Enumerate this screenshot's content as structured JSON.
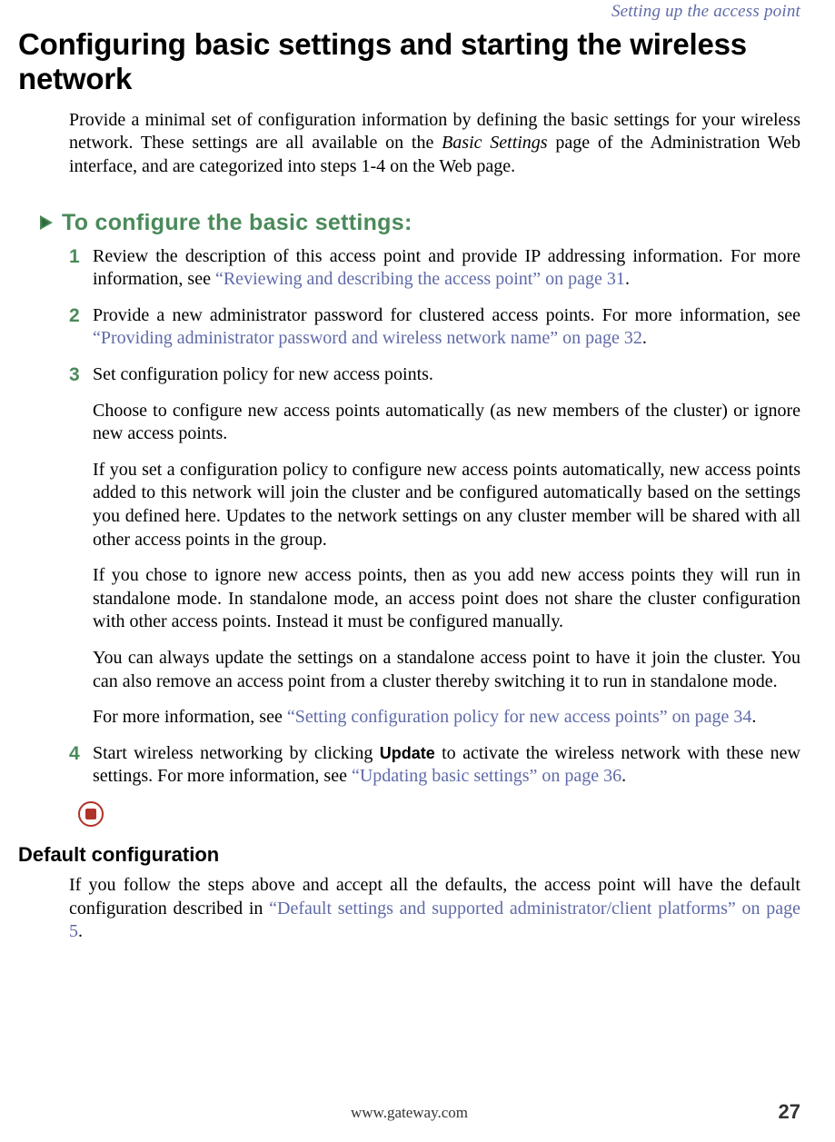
{
  "running_head": "Setting up the access point",
  "heading": "Configuring basic settings and starting the wireless network",
  "intro_a": "Provide a minimal set of configuration information by defining the basic settings for your wireless network. These settings are all available on the ",
  "intro_em": "Basic Settings",
  "intro_b": " page of the Administration Web interface, and are categorized into steps 1-4 on the Web page.",
  "procedure_title": "To configure the basic settings:",
  "steps": {
    "s1": {
      "num": "1",
      "a": "Review the description of this access point and provide IP addressing information. For more information, see ",
      "link": "“Reviewing and describing the access point” on page 31",
      "b": "."
    },
    "s2": {
      "num": "2",
      "a": "Provide a new administrator password for clustered access points. For more information, see ",
      "link": "“Providing administrator password and wireless network name” on page 32",
      "b": "."
    },
    "s3": {
      "num": "3",
      "a": "Set configuration policy for new access points.",
      "p1": "Choose to configure new access points automatically (as new members of the cluster) or ignore new access points.",
      "p2": "If you set a configuration policy to configure new access points automatically, new access points added to this network will join the cluster and be configured automatically based on the settings you defined here. Updates to the network settings on any cluster member will be shared with all other access points in the group.",
      "p3": "If you chose to ignore new access points, then as you add new access points they will run in standalone mode. In standalone mode, an access point does not share the cluster configuration with other access points. Instead it must be configured manually.",
      "p4": "You can always update the settings on a standalone access point to have it join the cluster. You can also remove an access point from a cluster thereby switching it to run in standalone mode.",
      "p5a": "For more information, see ",
      "p5link": "“Setting configuration policy for new access points” on page 34",
      "p5b": "."
    },
    "s4": {
      "num": "4",
      "a": "Start wireless networking by clicking ",
      "ui": "Update",
      "b": " to activate the wireless network with these new settings. For more information, see ",
      "link": "“Updating basic settings” on page 36",
      "c": "."
    }
  },
  "sub_heading": "Default configuration",
  "sub_a": "If you follow the steps above and accept all the defaults, the access point will have the default configuration described in ",
  "sub_link": "“Default settings and supported administrator/client platforms” on page 5",
  "sub_b": ".",
  "footer_url": "www.gateway.com",
  "page_number": "27"
}
